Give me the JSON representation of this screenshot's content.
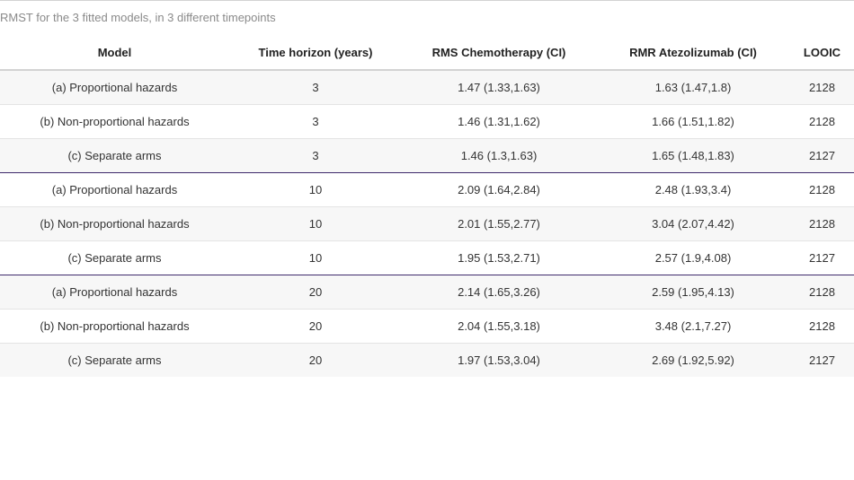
{
  "caption": "RMST for the 3 fitted models, in 3 different timepoints",
  "table": {
    "headers": {
      "model": "Model",
      "time": "Time horizon (years)",
      "chemo": "RMS Chemotherapy (CI)",
      "atezo": "RMR Atezolizumab (CI)",
      "looic": "LOOIC"
    },
    "rows": [
      {
        "model": "(a) Proportional hazards",
        "time": "3",
        "chemo": "1.47 (1.33,1.63)",
        "atezo": "1.63 (1.47,1.8)",
        "looic": "2128"
      },
      {
        "model": "(b) Non-proportional hazards",
        "time": "3",
        "chemo": "1.46 (1.31,1.62)",
        "atezo": "1.66 (1.51,1.82)",
        "looic": "2128"
      },
      {
        "model": "(c) Separate arms",
        "time": "3",
        "chemo": "1.46 (1.3,1.63)",
        "atezo": "1.65 (1.48,1.83)",
        "looic": "2127"
      },
      {
        "model": "(a) Proportional hazards",
        "time": "10",
        "chemo": "2.09 (1.64,2.84)",
        "atezo": "2.48 (1.93,3.4)",
        "looic": "2128"
      },
      {
        "model": "(b) Non-proportional hazards",
        "time": "10",
        "chemo": "2.01 (1.55,2.77)",
        "atezo": "3.04 (2.07,4.42)",
        "looic": "2128"
      },
      {
        "model": "(c) Separate arms",
        "time": "10",
        "chemo": "1.95 (1.53,2.71)",
        "atezo": "2.57 (1.9,4.08)",
        "looic": "2127"
      },
      {
        "model": "(a) Proportional hazards",
        "time": "20",
        "chemo": "2.14 (1.65,3.26)",
        "atezo": "2.59 (1.95,4.13)",
        "looic": "2128"
      },
      {
        "model": "(b) Non-proportional hazards",
        "time": "20",
        "chemo": "2.04 (1.55,3.18)",
        "atezo": "3.48 (2.1,7.27)",
        "looic": "2128"
      },
      {
        "model": "(c) Separate arms",
        "time": "20",
        "chemo": "1.97 (1.53,3.04)",
        "atezo": "2.69 (1.92,5.92)",
        "looic": "2127"
      }
    ]
  },
  "colors": {
    "group_divider": "#3f2a6b",
    "row_shade": "#f7f7f7",
    "caption_text": "#8a8a8a"
  }
}
